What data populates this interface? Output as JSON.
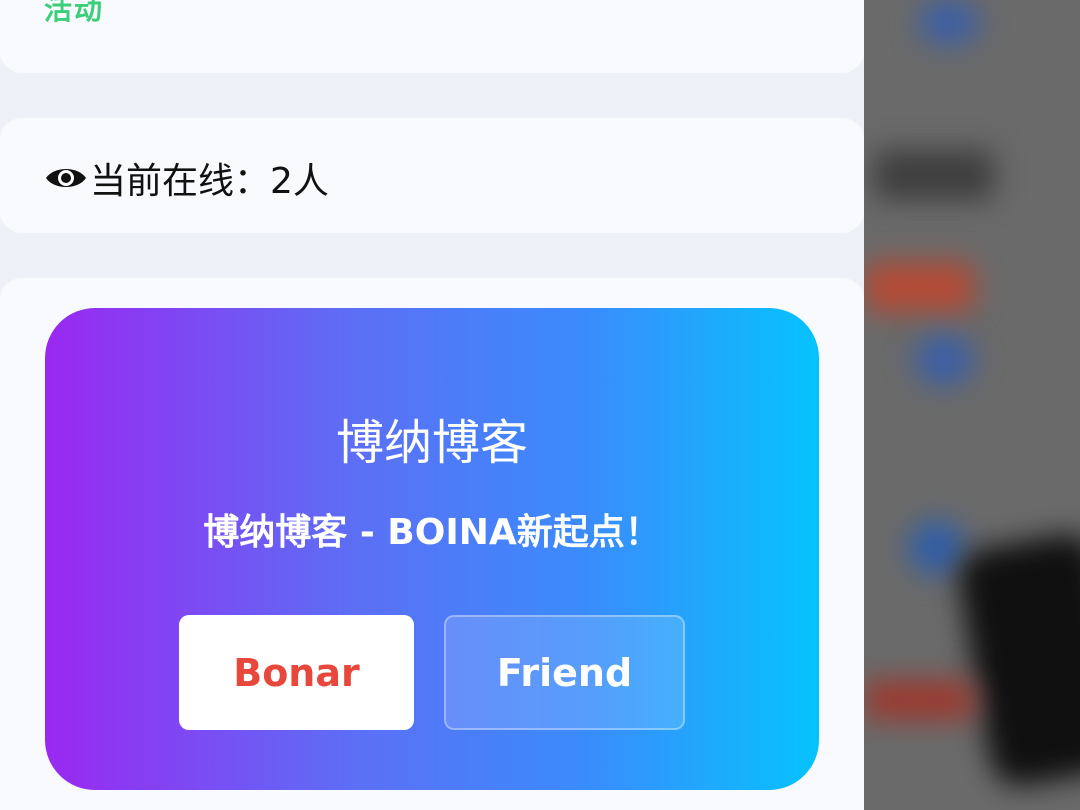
{
  "top_card": {
    "partial_text": "活动"
  },
  "online": {
    "icon": "eye-icon",
    "label": "当前在线：2人"
  },
  "ad_banner": {
    "title": "博纳博客",
    "subtitle": "博纳博客 - BOINA新起点！",
    "buttons": {
      "primary_label": "Bonar",
      "secondary_label": "Friend"
    },
    "colors": {
      "gradient_start": "#9a28f1",
      "gradient_end": "#06c3fc",
      "primary_text": "#e8473c"
    }
  }
}
